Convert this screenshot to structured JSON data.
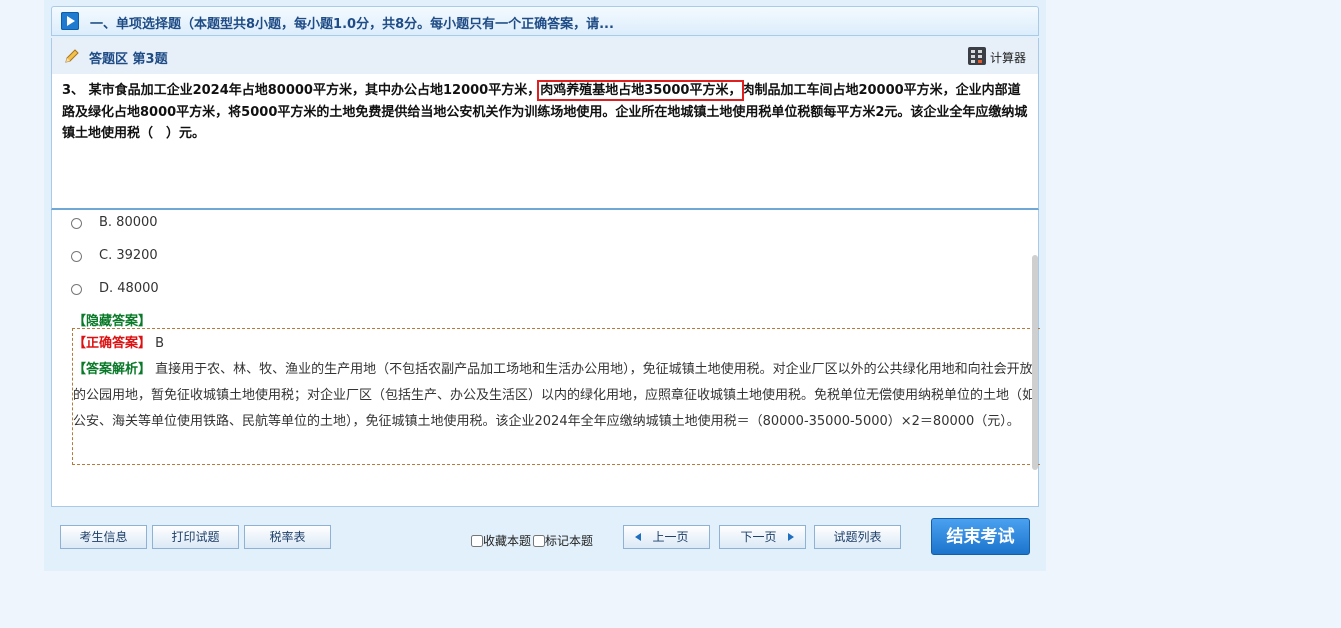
{
  "section": {
    "title": "一、单项选择题（本题型共8小题，每小题1.0分，共8分。每小题只有一个正确答案，请..."
  },
  "question_header": {
    "title": "答题区 第3题",
    "calculator_label": "计算器"
  },
  "question": {
    "part1": "3、 某市食品加工企业2024年占地80000平方米，其中办公占地12000平方米，",
    "highlighted": "肉鸡养殖基地占地35000平方米，",
    "part2": "肉制品加工车间占地20000平方米，企业内部道路及绿化占地8000平方米，将5000平方米的土地免费提供给当地公安机关作为训练场地使用。企业所在地城镇土地使用税单位税额每平方米2元。该企业全年应缴纳城镇土地使用税（　）元。"
  },
  "options": [
    {
      "label": "B. 80000"
    },
    {
      "label": "C. 39200"
    },
    {
      "label": "D. 48000"
    }
  ],
  "answer": {
    "hide_label": "【隐藏答案】",
    "correct_tag": "【正确答案】",
    "correct_value": "B",
    "analysis_tag": "【答案解析】",
    "analysis_text": "直接用于农、林、牧、渔业的生产用地（不包括农副产品加工场地和生活办公用地），免征城镇土地使用税。对企业厂区以外的公共绿化用地和向社会开放的公园用地，暂免征收城镇土地使用税；对企业厂区（包括生产、办公及生活区）以内的绿化用地，应照章征收城镇土地使用税。免税单位无偿使用纳税单位的土地（如公安、海关等单位使用铁路、民航等单位的土地），免征城镇土地使用税。该企业2024年全年应缴纳城镇土地使用税＝（80000-35000-5000）×2＝80000（元）。"
  },
  "toolbar": {
    "candidate_info": "考生信息",
    "print": "打印试题",
    "tax_table": "税率表",
    "favorite": "收藏本题",
    "mark": "标记本题",
    "prev": "上一页",
    "next": "下一页",
    "question_list": "试题列表",
    "finish": "结束考试"
  }
}
